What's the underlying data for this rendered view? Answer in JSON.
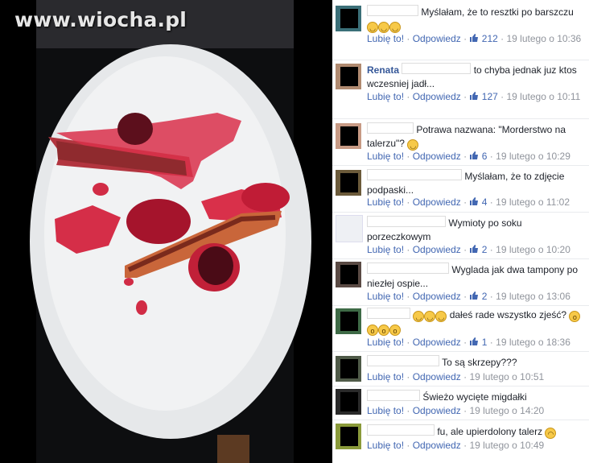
{
  "watermark": "www.wiocha.pl",
  "like_label": "Lubię to!",
  "reply_label": "Odpowiedz",
  "comments": [
    {
      "author": "",
      "text": "Myślałam, że to resztki po barszczu",
      "emoji": [
        "😂",
        "😂",
        "😂"
      ],
      "likes": "212",
      "time": "19 lutego o 10:36"
    },
    {
      "author": "Renata",
      "text": "to chyba jednak juz ktos wczesniej jadł...",
      "emoji": [],
      "likes": "127",
      "time": "19 lutego o 10:11"
    },
    {
      "author": "",
      "text": "Potrawa nazwana: \"Morderstwo na talerzu\"?",
      "emoji": [
        "🙂"
      ],
      "likes": "6",
      "time": "19 lutego o 10:29"
    },
    {
      "author": "",
      "text": "Myślałam, że to zdjęcie podpaski...",
      "emoji": [],
      "likes": "4",
      "time": "19 lutego o 11:02"
    },
    {
      "author": "",
      "text": "Wymioty po soku porzeczkowym",
      "emoji": [],
      "likes": "2",
      "time": "19 lutego o 10:20"
    },
    {
      "author": "",
      "text": "Wyglada jak dwa tampony po niezłej ospie...",
      "emoji": [],
      "likes": "2",
      "time": "19 lutego o 13:06"
    },
    {
      "author": "",
      "text": "dałeś rade wszystko zjeść?",
      "emoji": [
        "😂",
        "😂",
        "😂",
        "😱",
        "😱",
        "😱",
        "😱"
      ],
      "likes": "1",
      "time": "19 lutego o 18:36"
    },
    {
      "author": "",
      "text": "To są skrzepy???",
      "emoji": [],
      "likes": "",
      "time": "19 lutego o 10:51"
    },
    {
      "author": "",
      "text": "Świeżo wycięte migdałki",
      "emoji": [],
      "likes": "",
      "time": "19 lutego o 14:20"
    },
    {
      "author": "",
      "text": "fu, ale upierdolony talerz",
      "emoji": [
        "🙁"
      ],
      "likes": "",
      "time": "19 lutego o 10:49"
    }
  ]
}
